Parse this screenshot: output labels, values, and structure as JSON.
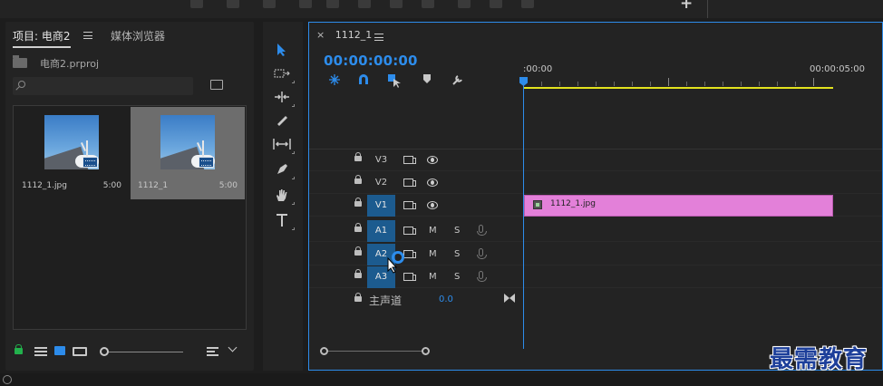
{
  "colors": {
    "accent": "#2d8ceb",
    "clip": "#e380d9",
    "work_area": "#e2e21e",
    "track_on": "#1c5b8f"
  },
  "project_panel": {
    "tabs": [
      {
        "label": "项目: 电商2",
        "active": true
      },
      {
        "label": "媒体浏览器",
        "active": false
      }
    ],
    "project_file": "电商2.prproj",
    "search": {
      "placeholder": ""
    },
    "items": [
      {
        "name": "1112_1.jpg",
        "duration": "5:00",
        "badge": "image-icon",
        "selected": false
      },
      {
        "name": "1112_1",
        "duration": "5:00",
        "badge": "sequence-icon",
        "selected": true
      }
    ]
  },
  "tools": [
    "selection-tool",
    "track-select-tool",
    "ripple-edit-tool",
    "razor-tool",
    "slip-tool",
    "pen-tool",
    "hand-tool",
    "type-tool"
  ],
  "timeline": {
    "tab_label": "1112_1",
    "close_symbol": "×",
    "timecode": "00:00:00:00",
    "ruler": {
      "start": ":00:00",
      "end": "00:00:05:00"
    },
    "video_tracks": [
      {
        "name": "V3",
        "targeted": false
      },
      {
        "name": "V2",
        "targeted": false
      },
      {
        "name": "V1",
        "targeted": true
      }
    ],
    "audio_tracks": [
      {
        "name": "A1",
        "targeted": true,
        "m": "M",
        "s": "S"
      },
      {
        "name": "A2",
        "targeted": true,
        "m": "M",
        "s": "S"
      },
      {
        "name": "A3",
        "targeted": true,
        "m": "M",
        "s": "S"
      }
    ],
    "clip": {
      "label": "1112_1.jpg",
      "track": "V1"
    },
    "master": {
      "label": "主声道",
      "value": "0.0"
    }
  },
  "watermark": "最需教育"
}
